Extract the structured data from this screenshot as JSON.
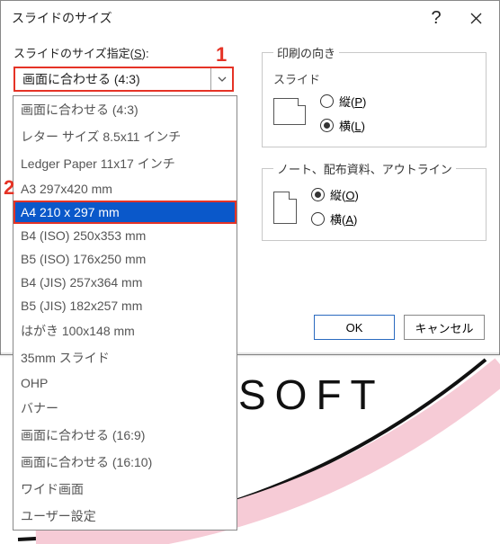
{
  "dialog": {
    "title": "スライドのサイズ",
    "size_label_prefix": "スライドのサイズ指定(",
    "size_label_key": "S",
    "size_label_suffix": "):",
    "combo_value": "画面に合わせる (4:3)",
    "options": [
      "画面に合わせる (4:3)",
      "レター サイズ 8.5x11 インチ",
      "Ledger Paper 11x17 インチ",
      "A3 297x420 mm",
      "A4 210 x 297 mm",
      "B4 (ISO) 250x353 mm",
      "B5 (ISO) 176x250 mm",
      "B4 (JIS) 257x364 mm",
      "B5 (JIS) 182x257 mm",
      "はがき 100x148 mm",
      "35mm スライド",
      "OHP",
      "バナー",
      "画面に合わせる (16:9)",
      "画面に合わせる (16:10)",
      "ワイド画面",
      "ユーザー設定"
    ],
    "selected_index": 4,
    "orientation_legend": "印刷の向き",
    "slides_label": "スライド",
    "notes_label": "ノート、配布資料、アウトライン",
    "portrait_label_prefix": "縦(",
    "landscape_label_prefix": "横(",
    "label_suffix": ")",
    "slides_portrait_key": "P",
    "slides_landscape_key": "L",
    "notes_portrait_key": "O",
    "notes_landscape_key": "A",
    "slides_orientation": "landscape",
    "notes_orientation": "portrait",
    "ok_label": "OK",
    "cancel_label": "キャンセル"
  },
  "annotations": {
    "marker1": "1",
    "marker2": "2"
  },
  "background": {
    "text": "SOFT"
  },
  "colors": {
    "annotation": "#e53326",
    "selection": "#0a58ca"
  }
}
